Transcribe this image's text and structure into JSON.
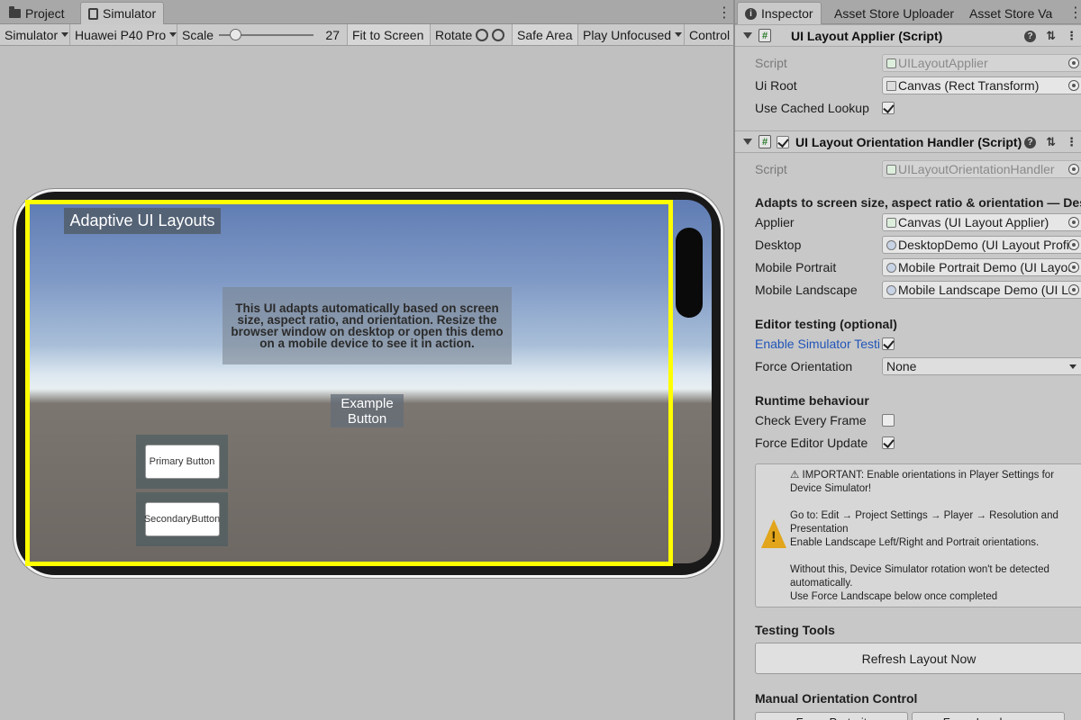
{
  "left_tabs": {
    "project": "Project",
    "simulator": "Simulator"
  },
  "toolbar": {
    "mode": "Simulator",
    "device": "Huawei P40 Pro",
    "scale_label": "Scale",
    "scale_value": "27",
    "scale_fraction": 0.18,
    "fit": "Fit to Screen",
    "rotate": "Rotate",
    "safe_area": "Safe Area",
    "play_mode": "Play Unfocused",
    "control": "Control"
  },
  "game": {
    "title": "Adaptive UI Layouts",
    "info": "This UI adapts automatically based on screen size, aspect ratio, and orientation. Resize the browser window on desktop or open this demo on a mobile device to see it in action.",
    "example_button": "Example Button",
    "primary_button": "Primary Button",
    "secondary_button": "SecondaryButton"
  },
  "right_tabs": {
    "inspector": "Inspector",
    "uploader": "Asset Store Uploader",
    "validator": "Asset Store Va"
  },
  "comp1": {
    "title": "UI Layout Applier (Script)",
    "script_label": "Script",
    "script_value": "UILayoutApplier",
    "root_label": "Ui Root",
    "root_value": "Canvas (Rect Transform)",
    "cached_label": "Use Cached Lookup"
  },
  "comp2": {
    "title": "UI Layout Orientation Handler (Script)",
    "script_label": "Script",
    "script_value": "UILayoutOrientationHandler",
    "adapts_heading": "Adapts to screen size, aspect ratio & orientation — Deskto",
    "applier_label": "Applier",
    "applier_value": "Canvas (UI Layout Applier)",
    "desktop_label": "Desktop",
    "desktop_value": "DesktopDemo (UI Layout Profil",
    "portrait_label": "Mobile Portrait",
    "portrait_value": "Mobile Portrait Demo (UI Layou",
    "landscape_label": "Mobile Landscape",
    "landscape_value": "Mobile Landscape Demo (UI La",
    "editor_heading": "Editor testing (optional)",
    "enable_sim_label": "Enable Simulator Testir",
    "force_orient_label": "Force Orientation",
    "force_orient_value": "None",
    "runtime_heading": "Runtime behaviour",
    "check_frame_label": "Check Every Frame",
    "force_update_label": "Force Editor Update",
    "help_lines": [
      "⚠ IMPORTANT: Enable orientations in Player Settings for Device Simulator!",
      "",
      "Go to: Edit → Project Settings → Player → Resolution and Presentation",
      "Enable Landscape Left/Right and Portrait orientations.",
      "",
      "Without this, Device Simulator rotation won't be detected automatically.",
      "Use Force Landscape below once completed"
    ],
    "testing_heading": "Testing Tools",
    "refresh_button": "Refresh Layout Now",
    "manual_heading": "Manual Orientation Control",
    "force_portrait_button": "Force Portrait",
    "force_landscape_button": "Force Landscape"
  }
}
